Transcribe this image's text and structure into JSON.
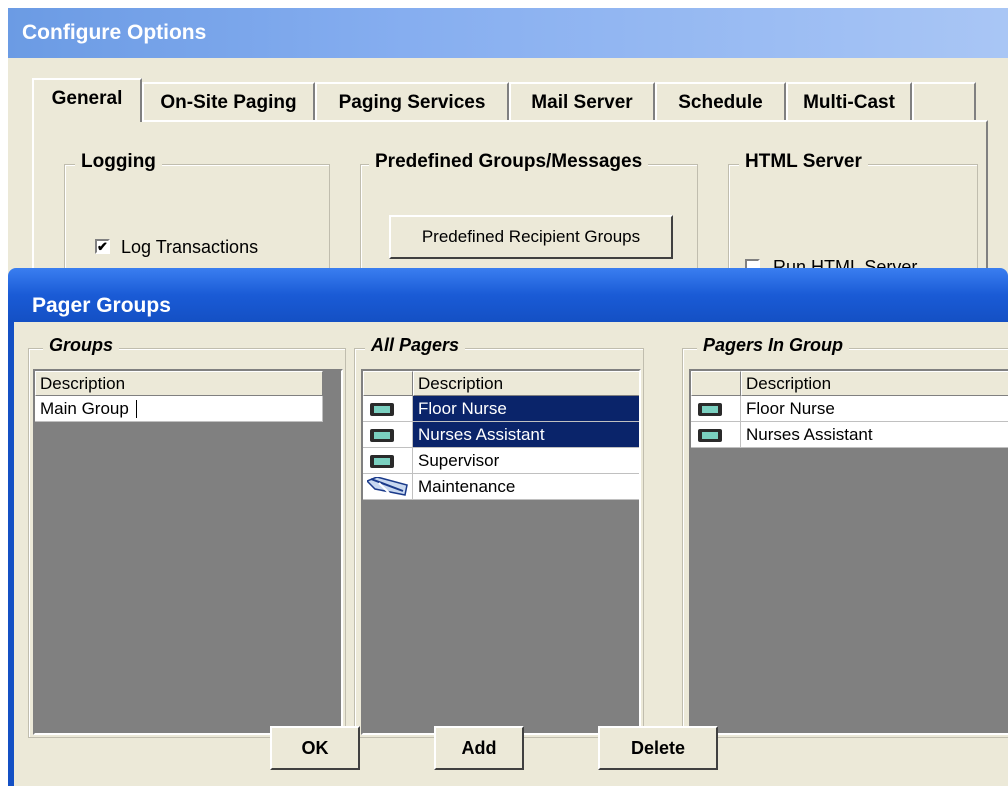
{
  "configure_window": {
    "title": "Configure Options",
    "tabs": [
      {
        "label": "General"
      },
      {
        "label": "On-Site Paging"
      },
      {
        "label": "Paging Services"
      },
      {
        "label": "Mail Server"
      },
      {
        "label": "Schedule"
      },
      {
        "label": "Multi-Cast"
      },
      {
        "label": ""
      }
    ],
    "active_tab": "General",
    "logging": {
      "title": "Logging",
      "log_transactions_label": "Log Transactions",
      "log_transactions_checked": true,
      "check_mark": "✔"
    },
    "predefined": {
      "title": "Predefined Groups/Messages",
      "recipient_groups_button": "Predefined Recipient Groups"
    },
    "html_server": {
      "title": "HTML Server",
      "run_label": "Run HTML Server",
      "run_checked": false
    }
  },
  "pager_groups_dialog": {
    "title": "Pager Groups",
    "groups": {
      "title": "Groups",
      "column_header": "Description",
      "rows": [
        "Main Group"
      ]
    },
    "all_pagers": {
      "title": "All Pagers",
      "column_header": "Description",
      "rows": [
        {
          "label": "Floor Nurse",
          "icon": "pager-icon",
          "selected": true
        },
        {
          "label": "Nurses Assistant",
          "icon": "pager-icon",
          "selected": true
        },
        {
          "label": "Supervisor",
          "icon": "pager-icon",
          "selected": false
        },
        {
          "label": "Maintenance",
          "icon": "wrench-icon",
          "selected": false
        }
      ]
    },
    "pagers_in_group": {
      "title": "Pagers In Group",
      "column_header": "Description",
      "rows": [
        {
          "label": "Floor Nurse",
          "icon": "pager-icon"
        },
        {
          "label": "Nurses Assistant",
          "icon": "pager-icon"
        }
      ]
    },
    "buttons": {
      "ok": "OK",
      "add": "Add",
      "delete": "Delete"
    }
  },
  "colors": {
    "selection": "#0a246a",
    "dialog_title": "#1a5bd6",
    "window_face": "#ece9d8",
    "grid_empty": "#808080"
  }
}
